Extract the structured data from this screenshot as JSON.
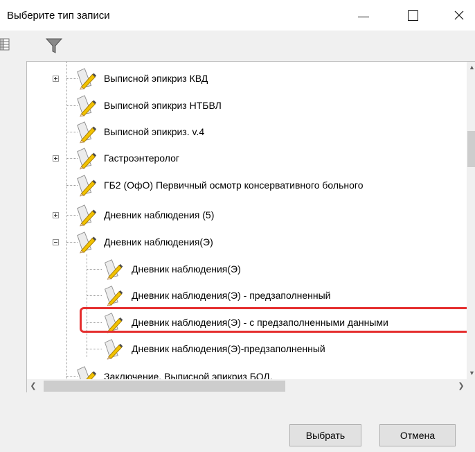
{
  "window": {
    "title": "Выберите тип записи"
  },
  "toolbar": {
    "icons": [
      "grid-view-icon",
      "filter-icon"
    ]
  },
  "tree": {
    "nodes": [
      {
        "label": "Выписной эпикриз КВД",
        "expander": "plus"
      },
      {
        "label": "Выписной эпикриз НТБВЛ",
        "expander": "none"
      },
      {
        "label": "Выписной эпикриз. v.4",
        "expander": "none"
      },
      {
        "label": "Гастроэнтеролог",
        "expander": "plus"
      },
      {
        "label": "ГБ2 (ОфО) Первичный осмотр  консервативного больного",
        "expander": "none"
      },
      {
        "label": "Дневник наблюдения (5)",
        "expander": "plus"
      },
      {
        "label": "Дневник наблюдения(Э)",
        "expander": "minus"
      },
      {
        "label": "Дневник наблюдения(Э)",
        "expander": "none",
        "level": 2
      },
      {
        "label": "Дневник наблюдения(Э) - предзаполненный",
        "expander": "none",
        "level": 2
      },
      {
        "label": "Дневник наблюдения(Э) - с предзаполненными данными",
        "expander": "none",
        "level": 2,
        "highlighted": true
      },
      {
        "label": "Дневник наблюдения(Э)-предзаполненный",
        "expander": "none",
        "level": 2
      },
      {
        "label": "Заключение. Выписной эпикриз БОД.",
        "expander": "none"
      }
    ]
  },
  "buttons": {
    "ok": "Выбрать",
    "cancel": "Отмена"
  },
  "colors": {
    "highlight": "#e52e2e",
    "pencil": "#f2c200",
    "paper": "#eeeeee"
  }
}
